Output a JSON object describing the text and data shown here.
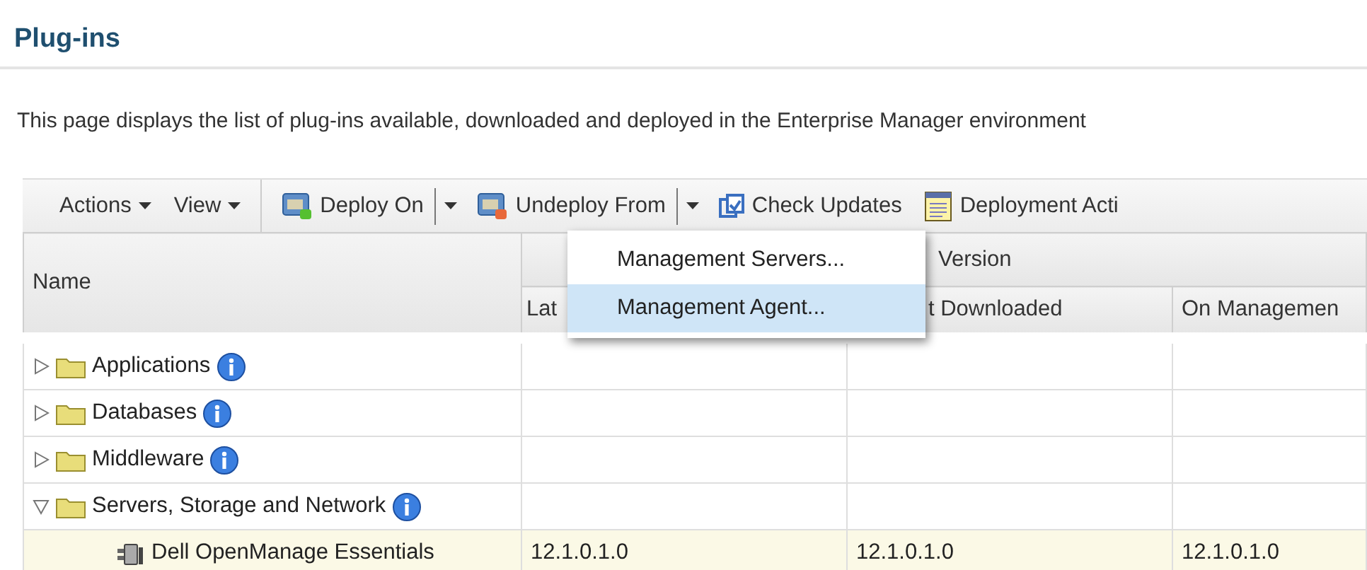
{
  "page": {
    "title": "Plug-ins",
    "description": "This page displays the list of plug-ins available, downloaded and deployed in the Enterprise Manager environment"
  },
  "toolbar": [
    {
      "kind": "menu",
      "label": "Actions"
    },
    {
      "kind": "menu",
      "label": "View"
    },
    {
      "kind": "split",
      "label": "Deploy On"
    },
    {
      "kind": "split",
      "label": "Undeploy From"
    },
    {
      "kind": "button",
      "label": "Check Updates"
    },
    {
      "kind": "button",
      "label": "Deployment Acti"
    }
  ],
  "table": {
    "columns": {
      "name": "Name",
      "group": "Version",
      "sub": [
        "Lat",
        "t Downloaded",
        "On Managemen"
      ]
    },
    "rows": [
      {
        "name": "Applications",
        "expanded": false,
        "selected": false,
        "children": []
      },
      {
        "name": "Databases",
        "expanded": false,
        "selected": false,
        "children": []
      },
      {
        "name": "Middleware",
        "expanded": false,
        "selected": false,
        "children": []
      },
      {
        "name": "Servers, Storage and Network",
        "expanded": true,
        "selected": false,
        "children": [
          {
            "name": "Dell OpenManage Essentials",
            "selected": true,
            "cells": [
              "12.1.0.1.0",
              "12.1.0.1.0",
              "12.1.0.1.0"
            ]
          }
        ]
      }
    ]
  },
  "dropdown_menu": [
    {
      "label": "Management Servers...",
      "selected": false
    },
    {
      "label": "Management Agent...",
      "selected": true
    }
  ]
}
